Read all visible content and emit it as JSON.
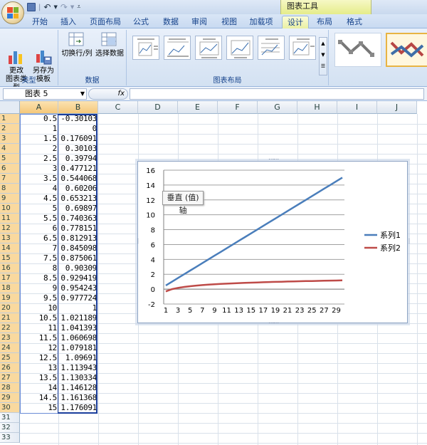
{
  "titlebar": {
    "chart_tools": "图表工具"
  },
  "tabs": [
    {
      "label": "开始"
    },
    {
      "label": "插入"
    },
    {
      "label": "页面布局"
    },
    {
      "label": "公式"
    },
    {
      "label": "数据"
    },
    {
      "label": "审阅"
    },
    {
      "label": "视图"
    },
    {
      "label": "加载项"
    },
    {
      "label": "设计",
      "active": true
    },
    {
      "label": "布局"
    },
    {
      "label": "格式"
    }
  ],
  "ribbon": {
    "type_group": {
      "label": "类型",
      "change_type": "更改\n图表类型",
      "save_template": "另存为\n模板"
    },
    "data_group": {
      "label": "数据",
      "switch_row_col": "切换行/列",
      "select_data": "选择数据"
    },
    "layout_group": {
      "label": "图表布局"
    }
  },
  "formula_bar": {
    "name_box": "图表 5",
    "fx": "fx",
    "formula": ""
  },
  "columns": [
    "A",
    "B",
    "C",
    "D",
    "E",
    "F",
    "G",
    "H",
    "I",
    "J"
  ],
  "rows": [
    "1",
    "2",
    "3",
    "4",
    "5",
    "6",
    "7",
    "8",
    "9",
    "10",
    "11",
    "12",
    "13",
    "14",
    "15",
    "16",
    "17",
    "18",
    "19",
    "20",
    "21",
    "22",
    "23",
    "24",
    "25",
    "26",
    "27",
    "28",
    "29",
    "30",
    "31",
    "32",
    "33"
  ],
  "cells_a": [
    "0.5",
    "1",
    "1.5",
    "2",
    "2.5",
    "3",
    "3.5",
    "4",
    "4.5",
    "5",
    "5.5",
    "6",
    "6.5",
    "7",
    "7.5",
    "8",
    "8.5",
    "9",
    "9.5",
    "10",
    "10.5",
    "11",
    "11.5",
    "12",
    "12.5",
    "13",
    "13.5",
    "14",
    "14.5",
    "15"
  ],
  "cells_b": [
    "-0.30103",
    "0",
    "0.176091",
    "0.30103",
    "0.39794",
    "0.477121",
    "0.544068",
    "0.60206",
    "0.653213",
    "0.69897",
    "0.740363",
    "0.778151",
    "0.812913",
    "0.845098",
    "0.875061",
    "0.90309",
    "0.929419",
    "0.954243",
    "0.977724",
    "1",
    "1.021189",
    "1.041393",
    "1.060698",
    "1.079181",
    "1.09691",
    "1.113943",
    "1.130334",
    "1.146128",
    "1.161368",
    "1.176091"
  ],
  "tooltip": "垂直 (值) 轴",
  "chart_data": {
    "type": "line",
    "title": "",
    "xlabel": "",
    "ylabel": "",
    "ylim": [
      -2,
      16
    ],
    "yticks": [
      "-2",
      "0",
      "2",
      "4",
      "6",
      "8",
      "10",
      "12",
      "14",
      "16"
    ],
    "x": [
      1,
      2,
      3,
      4,
      5,
      6,
      7,
      8,
      9,
      10,
      11,
      12,
      13,
      14,
      15,
      16,
      17,
      18,
      19,
      20,
      21,
      22,
      23,
      24,
      25,
      26,
      27,
      28,
      29,
      30
    ],
    "xtick_labels": [
      "1",
      "3",
      "5",
      "7",
      "9",
      "11",
      "13",
      "15",
      "17",
      "19",
      "21",
      "23",
      "25",
      "27",
      "29"
    ],
    "grid": true,
    "legend_position": "right",
    "series": [
      {
        "name": "系列1",
        "color": "#4a7ebb",
        "values": [
          0.5,
          1,
          1.5,
          2,
          2.5,
          3,
          3.5,
          4,
          4.5,
          5,
          5.5,
          6,
          6.5,
          7,
          7.5,
          8,
          8.5,
          9,
          9.5,
          10,
          10.5,
          11,
          11.5,
          12,
          12.5,
          13,
          13.5,
          14,
          14.5,
          15
        ]
      },
      {
        "name": "系列2",
        "color": "#be4b48",
        "values": [
          -0.30103,
          0,
          0.176091,
          0.30103,
          0.39794,
          0.477121,
          0.544068,
          0.60206,
          0.653213,
          0.69897,
          0.740363,
          0.778151,
          0.812913,
          0.845098,
          0.875061,
          0.90309,
          0.929419,
          0.954243,
          0.977724,
          1,
          1.021189,
          1.041393,
          1.060698,
          1.079181,
          1.09691,
          1.113943,
          1.130334,
          1.146128,
          1.161368,
          1.176091
        ]
      }
    ]
  }
}
